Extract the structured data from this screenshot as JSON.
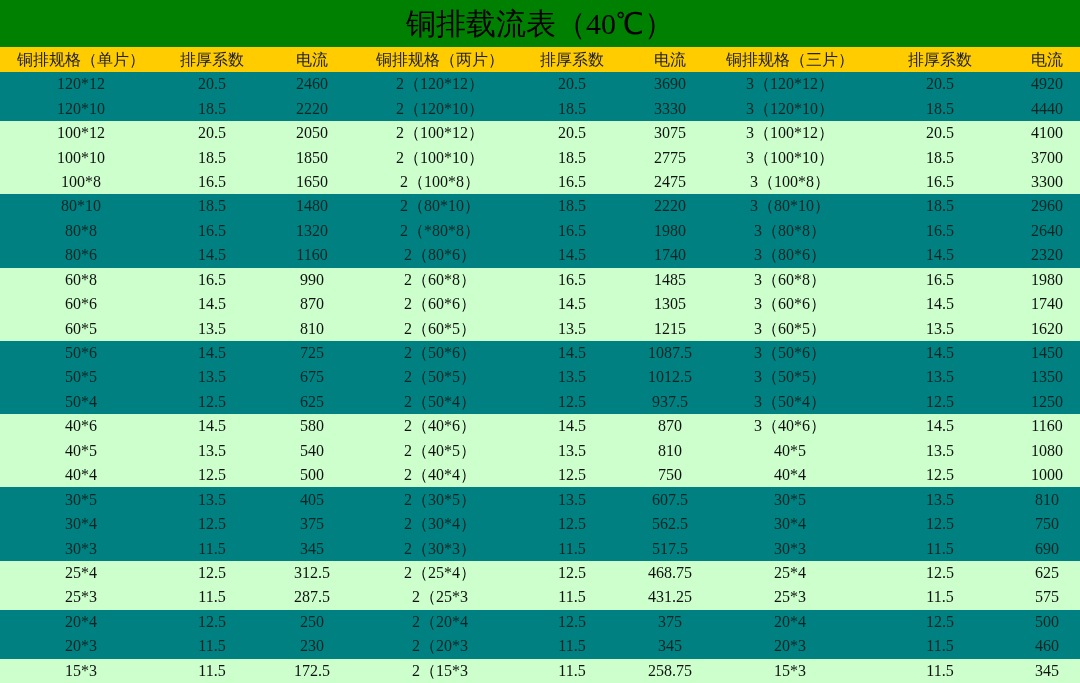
{
  "title": "铜排载流表（40℃）",
  "columns": [
    "铜排规格（单片）",
    "排厚系数",
    "电流",
    "铜排规格（两片）",
    "排厚系数",
    "电流",
    "铜排规格（三片）",
    "排厚系数",
    "电流"
  ],
  "groups": [
    {
      "kind": "dark",
      "rows": [
        [
          "120*12",
          "20.5",
          "2460",
          "2（120*12）",
          "20.5",
          "3690",
          "3（120*12）",
          "20.5",
          "4920"
        ],
        [
          "120*10",
          "18.5",
          "2220",
          "2（120*10）",
          "18.5",
          "3330",
          "3（120*10）",
          "18.5",
          "4440"
        ]
      ]
    },
    {
      "kind": "light",
      "rows": [
        [
          "100*12",
          "20.5",
          "2050",
          "2（100*12）",
          "20.5",
          "3075",
          "3（100*12）",
          "20.5",
          "4100"
        ],
        [
          "100*10",
          "18.5",
          "1850",
          "2（100*10）",
          "18.5",
          "2775",
          "3（100*10）",
          "18.5",
          "3700"
        ],
        [
          "100*8",
          "16.5",
          "1650",
          "2（100*8）",
          "16.5",
          "2475",
          "3（100*8）",
          "16.5",
          "3300"
        ]
      ]
    },
    {
      "kind": "dark",
      "rows": [
        [
          "80*10",
          "18.5",
          "1480",
          "2（80*10）",
          "18.5",
          "2220",
          "3（80*10）",
          "18.5",
          "2960"
        ],
        [
          "80*8",
          "16.5",
          "1320",
          "2（*80*8）",
          "16.5",
          "1980",
          "3（80*8）",
          "16.5",
          "2640"
        ],
        [
          "80*6",
          "14.5",
          "1160",
          "2（80*6）",
          "14.5",
          "1740",
          "3（80*6）",
          "14.5",
          "2320"
        ]
      ]
    },
    {
      "kind": "light",
      "rows": [
        [
          "60*8",
          "16.5",
          "990",
          "2（60*8）",
          "16.5",
          "1485",
          "3（60*8）",
          "16.5",
          "1980"
        ],
        [
          "60*6",
          "14.5",
          "870",
          "2（60*6）",
          "14.5",
          "1305",
          "3（60*6）",
          "14.5",
          "1740"
        ],
        [
          "60*5",
          "13.5",
          "810",
          "2（60*5）",
          "13.5",
          "1215",
          "3（60*5）",
          "13.5",
          "1620"
        ]
      ]
    },
    {
      "kind": "dark",
      "rows": [
        [
          "50*6",
          "14.5",
          "725",
          "2（50*6）",
          "14.5",
          "1087.5",
          "3（50*6）",
          "14.5",
          "1450"
        ],
        [
          "50*5",
          "13.5",
          "675",
          "2（50*5）",
          "13.5",
          "1012.5",
          "3（50*5）",
          "13.5",
          "1350"
        ],
        [
          "50*4",
          "12.5",
          "625",
          "2（50*4）",
          "12.5",
          "937.5",
          "3（50*4）",
          "12.5",
          "1250"
        ]
      ]
    },
    {
      "kind": "light",
      "rows": [
        [
          "40*6",
          "14.5",
          "580",
          "2（40*6）",
          "14.5",
          "870",
          "3（40*6）",
          "14.5",
          "1160"
        ],
        [
          "40*5",
          "13.5",
          "540",
          "2（40*5）",
          "13.5",
          "810",
          "40*5",
          "13.5",
          "1080"
        ],
        [
          "40*4",
          "12.5",
          "500",
          "2（40*4）",
          "12.5",
          "750",
          "40*4",
          "12.5",
          "1000"
        ]
      ]
    },
    {
      "kind": "dark",
      "rows": [
        [
          "30*5",
          "13.5",
          "405",
          "2（30*5）",
          "13.5",
          "607.5",
          "30*5",
          "13.5",
          "810"
        ],
        [
          "30*4",
          "12.5",
          "375",
          "2（30*4）",
          "12.5",
          "562.5",
          "30*4",
          "12.5",
          "750"
        ],
        [
          "30*3",
          "11.5",
          "345",
          "2（30*3）",
          "11.5",
          "517.5",
          "30*3",
          "11.5",
          "690"
        ]
      ]
    },
    {
      "kind": "light",
      "rows": [
        [
          "25*4",
          "12.5",
          "312.5",
          "2（25*4）",
          "12.5",
          "468.75",
          "25*4",
          "12.5",
          "625"
        ],
        [
          "25*3",
          "11.5",
          "287.5",
          "2（25*3",
          "11.5",
          "431.25",
          "25*3",
          "11.5",
          "575"
        ]
      ]
    },
    {
      "kind": "dark",
      "rows": [
        [
          "20*4",
          "12.5",
          "250",
          "2（20*4",
          "12.5",
          "375",
          "20*4",
          "12.5",
          "500"
        ],
        [
          "20*3",
          "11.5",
          "230",
          "2（20*3",
          "11.5",
          "345",
          "20*3",
          "11.5",
          "460"
        ]
      ]
    },
    {
      "kind": "light",
      "rows": [
        [
          "15*3",
          "11.5",
          "172.5",
          "2（15*3",
          "11.5",
          "258.75",
          "15*3",
          "11.5",
          "345"
        ]
      ]
    }
  ]
}
